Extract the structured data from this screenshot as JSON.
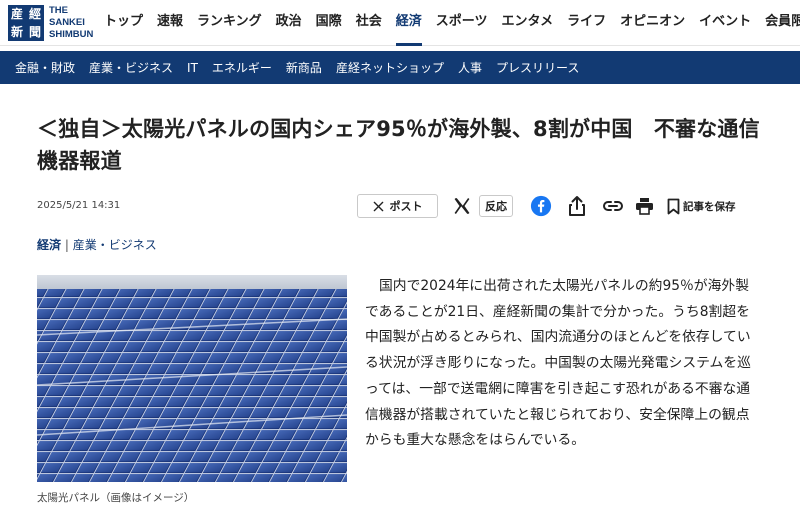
{
  "header": {
    "logo_chars": [
      "産",
      "經",
      "新",
      "聞"
    ],
    "logo_text": [
      "THE",
      "SANKEI",
      "SHIMBUN"
    ],
    "nav": [
      {
        "label": "トップ",
        "active": false
      },
      {
        "label": "速報",
        "active": false
      },
      {
        "label": "ランキング",
        "active": false
      },
      {
        "label": "政治",
        "active": false
      },
      {
        "label": "国際",
        "active": false
      },
      {
        "label": "社会",
        "active": false
      },
      {
        "label": "経済",
        "active": true
      },
      {
        "label": "スポーツ",
        "active": false
      },
      {
        "label": "エンタメ",
        "active": false
      },
      {
        "label": "ライフ",
        "active": false
      },
      {
        "label": "オピニオン",
        "active": false
      },
      {
        "label": "イベント",
        "active": false
      },
      {
        "label": "会員限定",
        "active": false
      }
    ],
    "subnav": [
      "金融・財政",
      "産業・ビジネス",
      "IT",
      "エネルギー",
      "新商品",
      "産経ネットショップ",
      "人事",
      "プレスリリース"
    ]
  },
  "article": {
    "headline": "＜独自＞太陽光パネルの国内シェア95％が海外製、8割が中国　不審な通信機器報道",
    "date": "2025/5/21 14:31",
    "share": {
      "post_label": "ポスト",
      "react_label": "反応",
      "save_label": "記事を保存"
    },
    "category": {
      "main": "経済",
      "separator": "|",
      "sub": "産業・ビジネス"
    },
    "caption": "太陽光パネル（画像はイメージ）",
    "body": "国内で2024年に出荷された太陽光パネルの約95％が海外製であることが21日、産経新聞の集計で分かった。うち8割超を中国製が占めるとみられ、国内流通分のほとんどを依存している状況が浮き彫りになった。中国製の太陽光発電システムを巡っては、一部で送電網に障害を引き起こす恐れがある不審な通信機器が搭載されていたと報じられており、安全保障上の観点からも重大な懸念をはらんでいる。"
  },
  "colors": {
    "brand": "#123a73",
    "facebook": "#1877f2"
  },
  "icons": [
    "x-logo-icon",
    "facebook-icon",
    "share-icon",
    "link-icon",
    "print-icon",
    "bookmark-icon"
  ]
}
